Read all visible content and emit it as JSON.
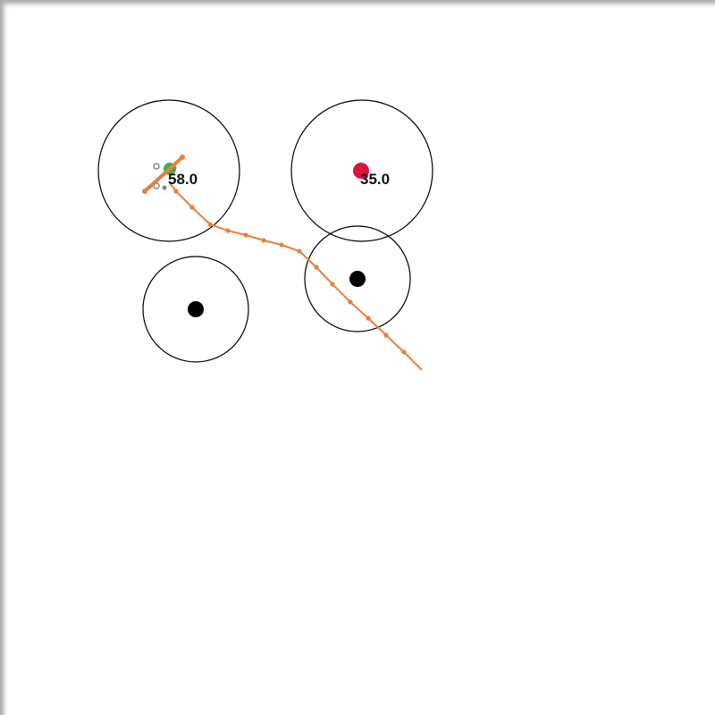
{
  "colors": {
    "background": "#ffffff",
    "ring_stroke": "#000000",
    "target_fill": "#000000",
    "goal_fill": "#dc143c",
    "agent_fill": "#3cb043",
    "path_color": "#e8803c",
    "gripper_color": "#7a8a96"
  },
  "zones": [
    {
      "name": "zone-agent",
      "label": "58.0"
    },
    {
      "name": "zone-goal",
      "label": "35.0"
    },
    {
      "name": "zone-target-left",
      "label": ""
    },
    {
      "name": "zone-target-right",
      "label": ""
    }
  ],
  "markers": {
    "goal": "goal-dot",
    "targets": [
      "target-dot-left",
      "target-dot-right"
    ],
    "agent": "agent-icon"
  },
  "trajectory": {
    "description_icon": "trajectory-path",
    "visible": true
  }
}
